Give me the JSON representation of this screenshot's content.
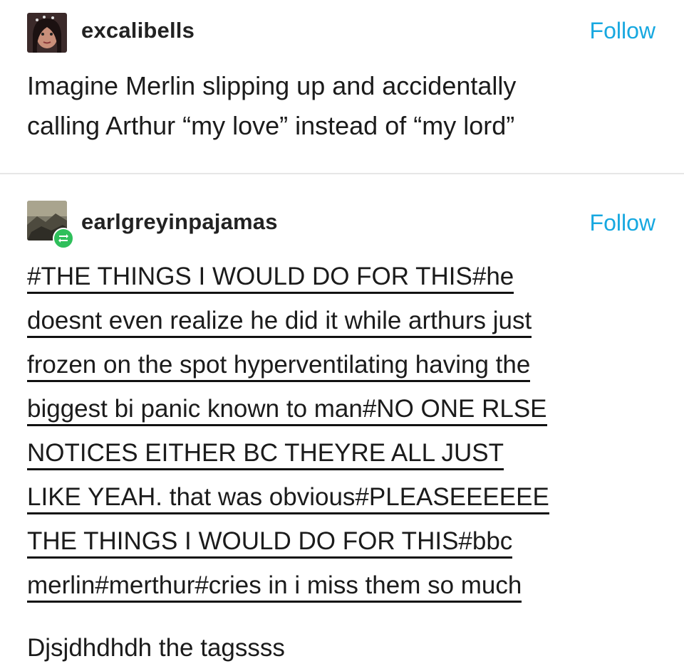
{
  "posts": [
    {
      "username": "excalibells",
      "follow_label": "Follow",
      "body_lines": [
        "Imagine Merlin slipping up and accidentally",
        "calling Arthur “my love” instead of “my lord”"
      ]
    },
    {
      "username": "earlgreyinpajamas",
      "follow_label": "Follow",
      "tag_lines": [
        "#THE THINGS I WOULD DO FOR THIS#he",
        "doesnt even realize he did it while arthurs just",
        "frozen on the spot hyperventilating having the",
        "biggest bi panic known to man#NO ONE RLSE",
        "NOTICES EITHER BC THEYRE ALL JUST",
        "LIKE YEAH. that was obvious#PLEASEEEEEE",
        "THE THINGS I WOULD DO FOR THIS#bbc",
        "merlin#merthur#cries in i miss them so much"
      ],
      "reply": "Djsjdhdhdh the tagssss"
    }
  ],
  "icons": {
    "reblog": "reblog-icon"
  },
  "colors": {
    "follow": "#17a8e0",
    "reblog_badge": "#2fbf5b"
  }
}
